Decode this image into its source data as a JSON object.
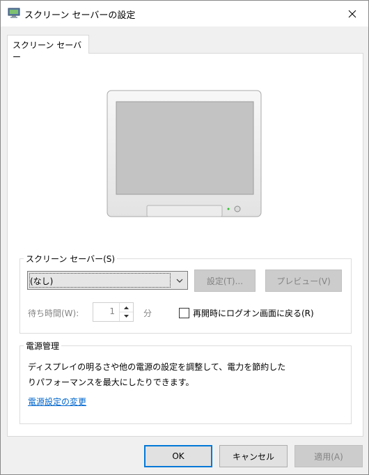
{
  "window": {
    "title": "スクリーン セーバーの設定"
  },
  "tab": {
    "label": "スクリーン セーバー"
  },
  "screensaver_group": {
    "label": "スクリーン セーバー(S)",
    "select_value": "(なし)",
    "settings_label": "設定(T)...",
    "preview_label": "プレビュー(V)",
    "wait_label": "待ち時間(W):",
    "wait_value": "1",
    "wait_unit": "分",
    "resume_checkbox_label": "再開時にログオン画面に戻る(R)",
    "resume_checked": false
  },
  "power_group": {
    "label": "電源管理",
    "description_line1": "ディスプレイの明るさや他の電源の設定を調整して、電力を節約した",
    "description_line2": "りパフォーマンスを最大にしたりできます。",
    "link": "電源設定の変更"
  },
  "footer": {
    "ok": "OK",
    "cancel": "キャンセル",
    "apply": "適用(A)"
  },
  "colors": {
    "link": "#0066cc",
    "ok_border": "#0078d7",
    "disabled_text": "#838383"
  },
  "icons": [
    "app-icon",
    "close-icon",
    "chevron-down-icon",
    "spin-up-icon",
    "spin-down-icon"
  ]
}
